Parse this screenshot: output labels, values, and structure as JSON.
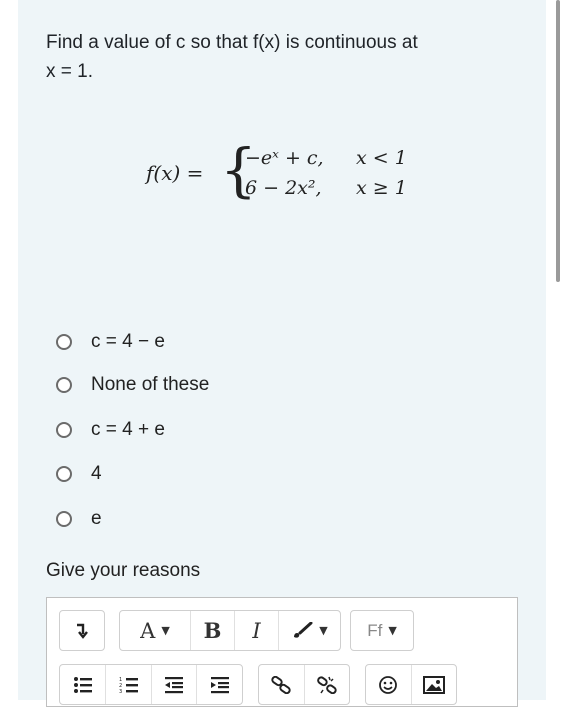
{
  "question": {
    "line1": "Find a value of c so that f(x) is continuous at",
    "line2": "x = 1."
  },
  "formula": {
    "lhs": "f(x) =",
    "case1_expr": "−eˣ + c,",
    "case1_cond": "x < 1",
    "case2_expr": "6 − 2x²,",
    "case2_cond": "x ≥ 1"
  },
  "options": [
    {
      "label": "c = 4 − e"
    },
    {
      "label": "None of these"
    },
    {
      "label": "c = 4 + e"
    },
    {
      "label": "4"
    },
    {
      "label": "e"
    }
  ],
  "reasons_label": "Give your reasons",
  "toolbar": {
    "format_label": "A",
    "bold_label": "B",
    "italic_label": "I",
    "font_label": "Ff"
  }
}
